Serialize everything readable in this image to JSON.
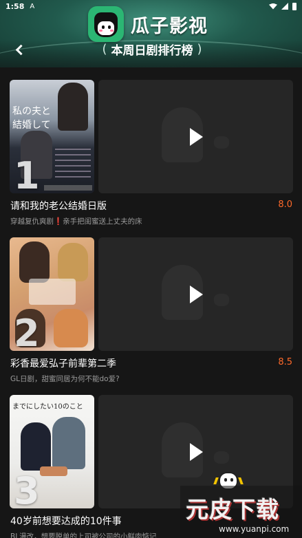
{
  "status_bar": {
    "time": "1:58",
    "notif": "A"
  },
  "header": {
    "app_name": "瓜子影视",
    "ranking_title": "本周日剧排行榜",
    "paren_left": "(",
    "paren_right": ")"
  },
  "items": [
    {
      "rank": "1",
      "title": "请和我的老公结婚日版",
      "score": "8.0",
      "desc_before": "穿越复仇爽剧",
      "desc_mark": "❗",
      "desc_after": "亲手把闺蜜送上丈夫的床",
      "poster_text": "私の夫と\n結婚して"
    },
    {
      "rank": "2",
      "title": "彩香最爱弘子前辈第二季",
      "score": "8.5",
      "desc_before": "GL日剧，甜蜜同居为何不能do爱?",
      "desc_mark": "",
      "desc_after": ""
    },
    {
      "rank": "3",
      "title": "40岁前想要达成的10件事",
      "score": "",
      "desc_before": "BL漫改，想要脱单的上司被公司的小鲜肉惦记",
      "desc_mark": "",
      "desc_after": "",
      "poster_text": "までにしたい10のこと"
    }
  ],
  "watermark": {
    "brand": "元皮下载",
    "url": "www.yuanpi.com"
  },
  "colors": {
    "score": "#ff6a2a",
    "header_green": "#215a4d",
    "background": "#161616"
  }
}
